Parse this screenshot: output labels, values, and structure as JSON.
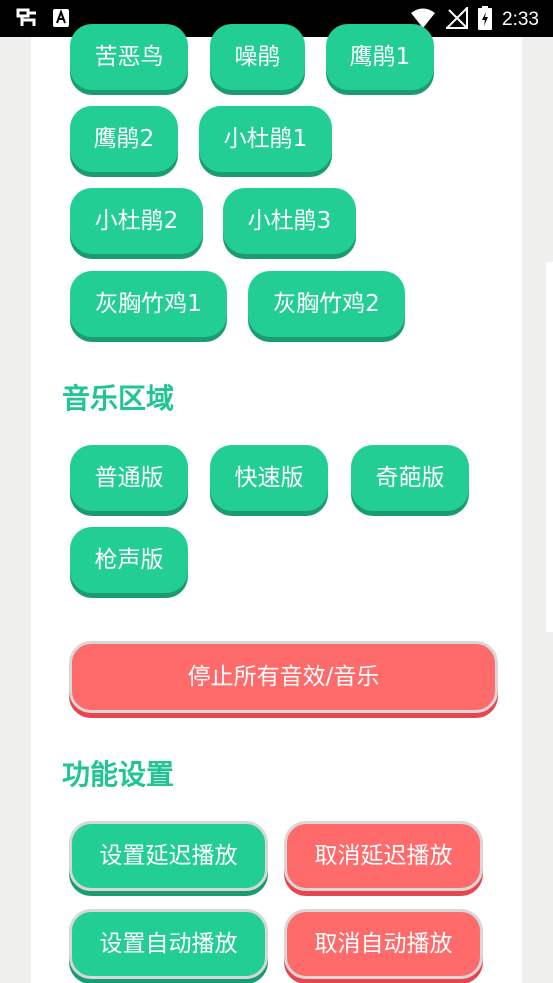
{
  "status_bar": {
    "time": "2:33",
    "left_icons": [
      "bug-icon",
      "a-box-icon"
    ],
    "right_icons": [
      "wifi-icon",
      "no-signal-icon",
      "battery-charging-icon"
    ]
  },
  "bird_buttons": [
    "苦恶鸟",
    "噪鹃",
    "鹰鹃1",
    "鹰鹃2",
    "小杜鹃1",
    "小杜鹃2",
    "小杜鹃3",
    "灰胸竹鸡1",
    "灰胸竹鸡2"
  ],
  "music_section": {
    "title": "音乐区域",
    "buttons": [
      "普通版",
      "快速版",
      "奇葩版",
      "枪声版"
    ]
  },
  "stop_button": "停止所有音效/音乐",
  "settings_section": {
    "title": "功能设置",
    "set_delay": "设置延迟播放",
    "cancel_delay": "取消延迟播放",
    "set_auto": "设置自动播放",
    "cancel_auto": "取消自动播放"
  },
  "colors": {
    "green": "#22ce94",
    "red": "#ff6b6b",
    "title_green": "#22c493"
  }
}
